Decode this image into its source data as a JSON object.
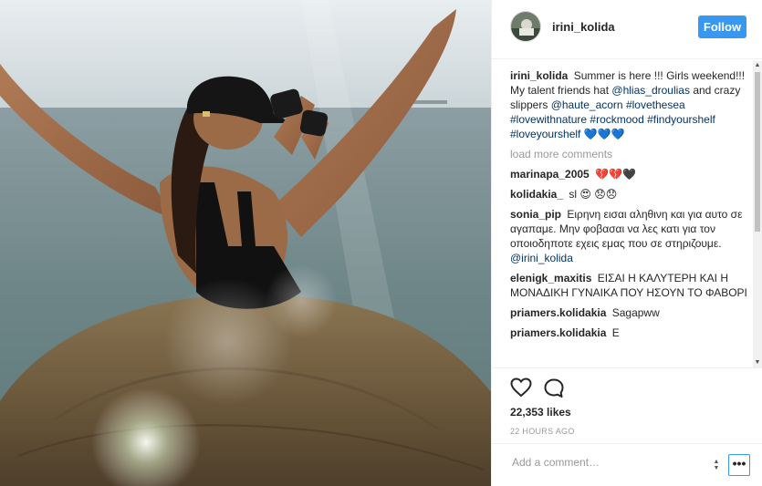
{
  "header": {
    "username": "irini_kolida",
    "follow_label": "Follow"
  },
  "caption": {
    "username": "irini_kolida",
    "text_1": "Summer is here !!! Girls weekend!!!",
    "text_2": "My talent friends hat",
    "mention_1": "@hlias_droulias",
    "text_3": "and crazy slippers",
    "mention_2": "@haute_acorn",
    "tag_1": "#lovethesea",
    "tag_2": "#lovewithnature",
    "tag_3": "#rockmood",
    "tag_4": "#findyourshelf",
    "tag_5": "#loveyourshelf",
    "emoji": "💙💙💙"
  },
  "load_more": "load more comments",
  "comments": [
    {
      "username": "marinapa_2005",
      "text": "💔💔🖤"
    },
    {
      "username": "kolidakia_",
      "text": "sl 😍 😞😞"
    },
    {
      "username": "sonia_pip",
      "text": "Ειρηνη εισαι αληθινη και για αυτο σε αγαπαμε. Μην φοβασαι να λες κατι για τον οποιοδηποτε εχεις εμας που σε στηριζουμε.",
      "mention": "@irini_kolida"
    },
    {
      "username": "elenigk_maxitis",
      "text": "ΕΙΣΑΙ Η ΚΑΛΥΤΕΡΗ ΚΑΙ Η ΜΟΝΑΔΙΚΗ ΓΥΝΑΙΚΑ ΠΟΥ ΗΣΟΥΝ ΤΟ ΦΑΒΟΡΙ"
    },
    {
      "username": "priamers.kolidakia",
      "text": "Sagapww"
    },
    {
      "username": "priamers.kolidakia",
      "text": "Ε"
    }
  ],
  "likes": "22,353 likes",
  "time_ago": "22 HOURS AGO",
  "add_comment": {
    "placeholder": "Add a comment…"
  },
  "more_label": "•••",
  "icons": {
    "like": "heart-icon",
    "comment": "comment-icon",
    "more": "more-options-icon"
  },
  "colors": {
    "follow": "#3897f0",
    "link": "#003569",
    "muted": "#999999"
  }
}
